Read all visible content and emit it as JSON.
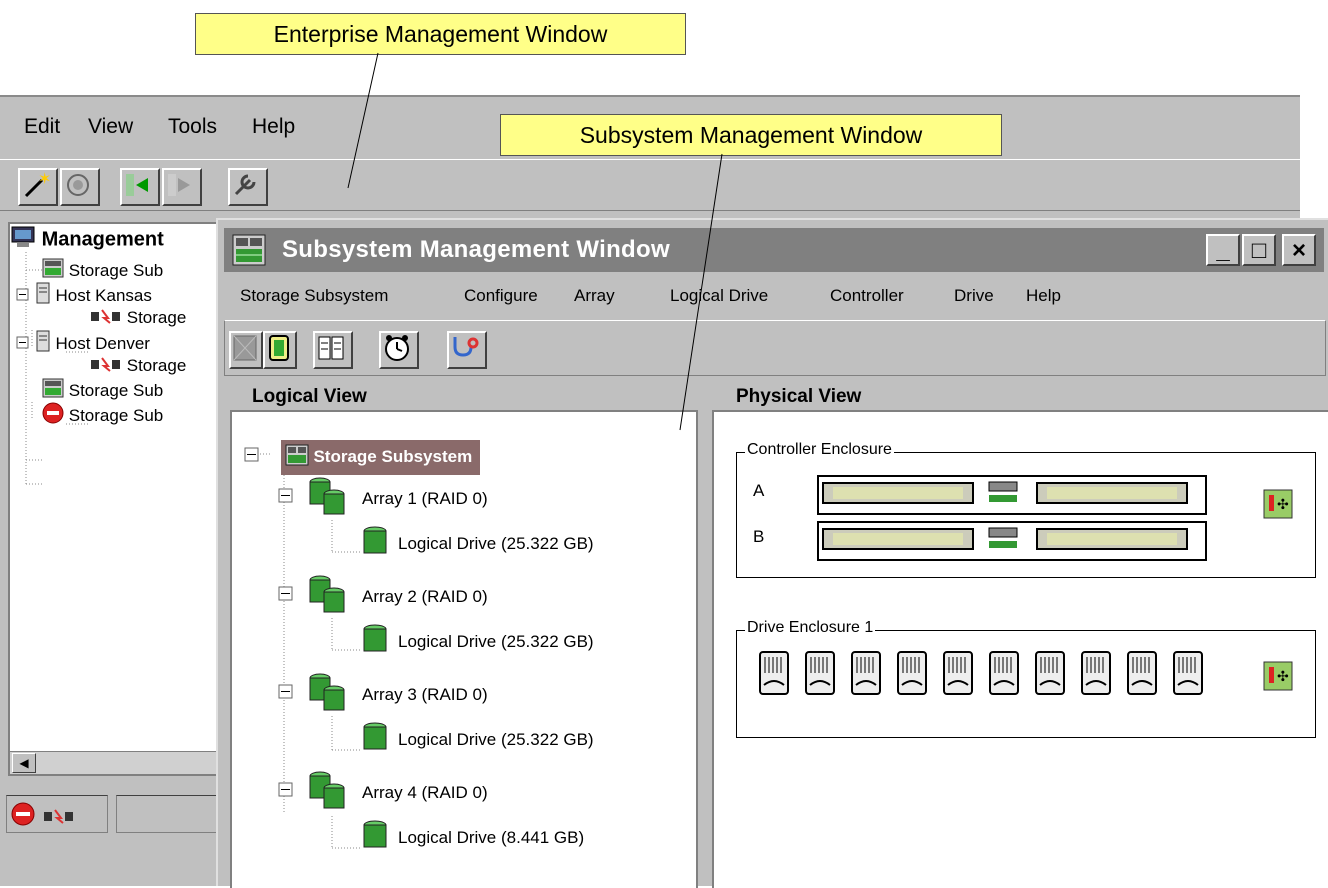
{
  "callouts": {
    "enterprise": "Enterprise Management Window",
    "subsystem": "Subsystem Management Window"
  },
  "enterprise_window": {
    "menu": [
      "Edit",
      "View",
      "Tools",
      "Help"
    ],
    "toolbar_icons": [
      "wand-icon",
      "discover-icon",
      "add-icon",
      "remove-icon",
      "wrench-icon"
    ],
    "tree_root": "Management",
    "tree": [
      {
        "label": "Storage Sub",
        "icon": "storage-subsystem-icon"
      },
      {
        "label": "Host Kansas",
        "icon": "host-icon"
      },
      {
        "label": "Storage",
        "icon": "host-agent-icon"
      },
      {
        "label": "Host Denver",
        "icon": "host-icon"
      },
      {
        "label": "Storage",
        "icon": "host-agent-icon"
      },
      {
        "label": "Storage Sub",
        "icon": "storage-subsystem-icon"
      },
      {
        "label": "Storage Sub",
        "icon": "stop-alert-icon"
      }
    ]
  },
  "subsystem_window": {
    "title": "Subsystem Management Window",
    "controls": [
      "_",
      "□",
      "×"
    ],
    "menu": [
      "Storage Subsystem",
      "Configure",
      "Array",
      "Logical Drive",
      "Controller",
      "Drive",
      "Help"
    ],
    "toolbar_icons": [
      "storage-icon",
      "array-icon",
      "book-icon",
      "clock-icon",
      "stethoscope-icon"
    ],
    "logical_view": {
      "heading": "Logical View",
      "root": "Storage Subsystem",
      "arrays": [
        {
          "label": "Array 1 (RAID 0)",
          "drive": "Logical Drive (25.322 GB)"
        },
        {
          "label": "Array 2 (RAID 0)",
          "drive": "Logical Drive (25.322 GB)"
        },
        {
          "label": "Array 3 (RAID 0)",
          "drive": "Logical Drive (25.322 GB)"
        },
        {
          "label": "Array 4 (RAID 0)",
          "drive": "Logical Drive (8.441 GB)"
        }
      ]
    },
    "physical_view": {
      "heading": "Physical View",
      "controller_enclosure": "Controller Enclosure",
      "controllers": [
        "A",
        "B"
      ],
      "drive_enclosure": "Drive Enclosure 1",
      "drive_count": 10
    }
  }
}
